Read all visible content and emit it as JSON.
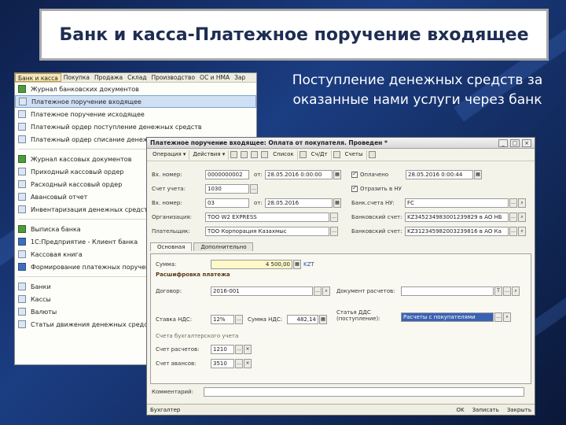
{
  "slide": {
    "title": "Банк и касса-Платежное поручение входящее",
    "caption": "Поступление денежных средств за оказанные нами услуги через банк"
  },
  "menu_window": {
    "menubar": [
      "Банк и касса",
      "Покупка",
      "Продажа",
      "Склад",
      "Производство",
      "ОС и НМА",
      "Зар"
    ],
    "items": [
      {
        "label": "Журнал банковских документов",
        "icon": "journal-icon"
      },
      {
        "label": "Платежное поручение входящее",
        "icon": "document-icon",
        "selected": true
      },
      {
        "label": "Платежное поручение исходящее",
        "icon": "document-icon"
      },
      {
        "label": "Платежный ордер поступление денежных средств",
        "icon": "document-icon"
      },
      {
        "label": "Платежный ордер списание денежных средств",
        "icon": "document-icon"
      },
      {
        "label": "Журнал кассовых документов",
        "icon": "journal-icon"
      },
      {
        "label": "Приходный кассовый ордер",
        "icon": "document-icon"
      },
      {
        "label": "Расходный кассовый ордер",
        "icon": "document-icon"
      },
      {
        "label": "Авансовый отчет",
        "icon": "document-icon"
      },
      {
        "label": "Инвентаризация денежных средств",
        "icon": "document-icon"
      },
      {
        "label": "Выписка банка",
        "icon": "statement-icon"
      },
      {
        "label": "1С:Предприятие - Клиент банка",
        "icon": "client-bank-icon"
      },
      {
        "label": "Кассовая книга",
        "icon": "book-icon"
      },
      {
        "label": "Формирование платежных поручений",
        "icon": "form-icon"
      },
      {
        "label": "Банки",
        "icon": "list-icon"
      },
      {
        "label": "Кассы",
        "icon": "list-icon"
      },
      {
        "label": "Валюты",
        "icon": "list-icon"
      },
      {
        "label": "Статьи движения денежных средств",
        "icon": "list-icon"
      }
    ]
  },
  "doc_window": {
    "title": "Платежное поручение входящее: Оплата от покупателя. Проведен *",
    "toolbar": {
      "operation": "Операция ▾",
      "actions": "Действия ▾",
      "list": "Список",
      "subconto": "Сч/Дт",
      "invoices": "Счеты"
    },
    "fields": {
      "vh_number_label": "Вх. номер:",
      "vh_number": "0000000002",
      "date_label": "от:",
      "date": "28.05.2016 0:00:00",
      "paid_label": "Оплачено",
      "paid_date": "28.05.2016 0:00:44",
      "account_label": "Счет учета:",
      "account": "1030",
      "reflect_label": "Отразить в НУ",
      "in_number_label": "Вх. номер:",
      "in_number": "03",
      "in_date_label": "от:",
      "in_date": "28.05.2016",
      "bank_account_label": "Банк.счета НУ:",
      "bank_account": "FC",
      "org_label": "Организация:",
      "org": "ТОО W2 EXPRESS",
      "bank_acc1_label": "Банковский счет:",
      "bank_acc1": "KZ345234983001239829 в АО НБ",
      "payer_label": "Плательщик:",
      "payer": "ТОО Корпорация Казахмыс",
      "bank_acc2_label": "Банковский счет:",
      "bank_acc2": "KZ312345982003239816 в АО Ка"
    },
    "tabs": [
      "Основная",
      "Дополнительно"
    ],
    "main_tab": {
      "sum_label": "Сумма:",
      "sum": "4 500,00",
      "currency": "KZT",
      "decoding_header": "Расшифровка платежа",
      "contract_label": "Договор:",
      "contract": "2016-001",
      "doc_calc_label": "Документ расчетов:",
      "doc_calc": "",
      "vat_rate_label": "Ставка НДС:",
      "vat_rate": "12%",
      "vat_sum_label": "Сумма НДС:",
      "vat_sum": "482,14",
      "dds_label": "Статья ДДС",
      "dds_sub": "(поступление):",
      "dds": "Расчеты с покупателями",
      "accounting_header": "Счета бухгалтерского учета",
      "calc_account_label": "Счет расчетов:",
      "calc_account": "1210",
      "advance_account_label": "Счет авансов:",
      "advance_account": "3510"
    },
    "comment_label": "Комментарий:",
    "comment": "",
    "status": {
      "left": "Бухгалтер",
      "ok": "OK",
      "write": "Записать",
      "close": "Закрыть"
    }
  },
  "colors": {
    "slide_bg": "#1b3d82",
    "title_text": "#1e2d52",
    "selected_item": "#cfe0f4",
    "field_highlight": "#fff8c8"
  }
}
